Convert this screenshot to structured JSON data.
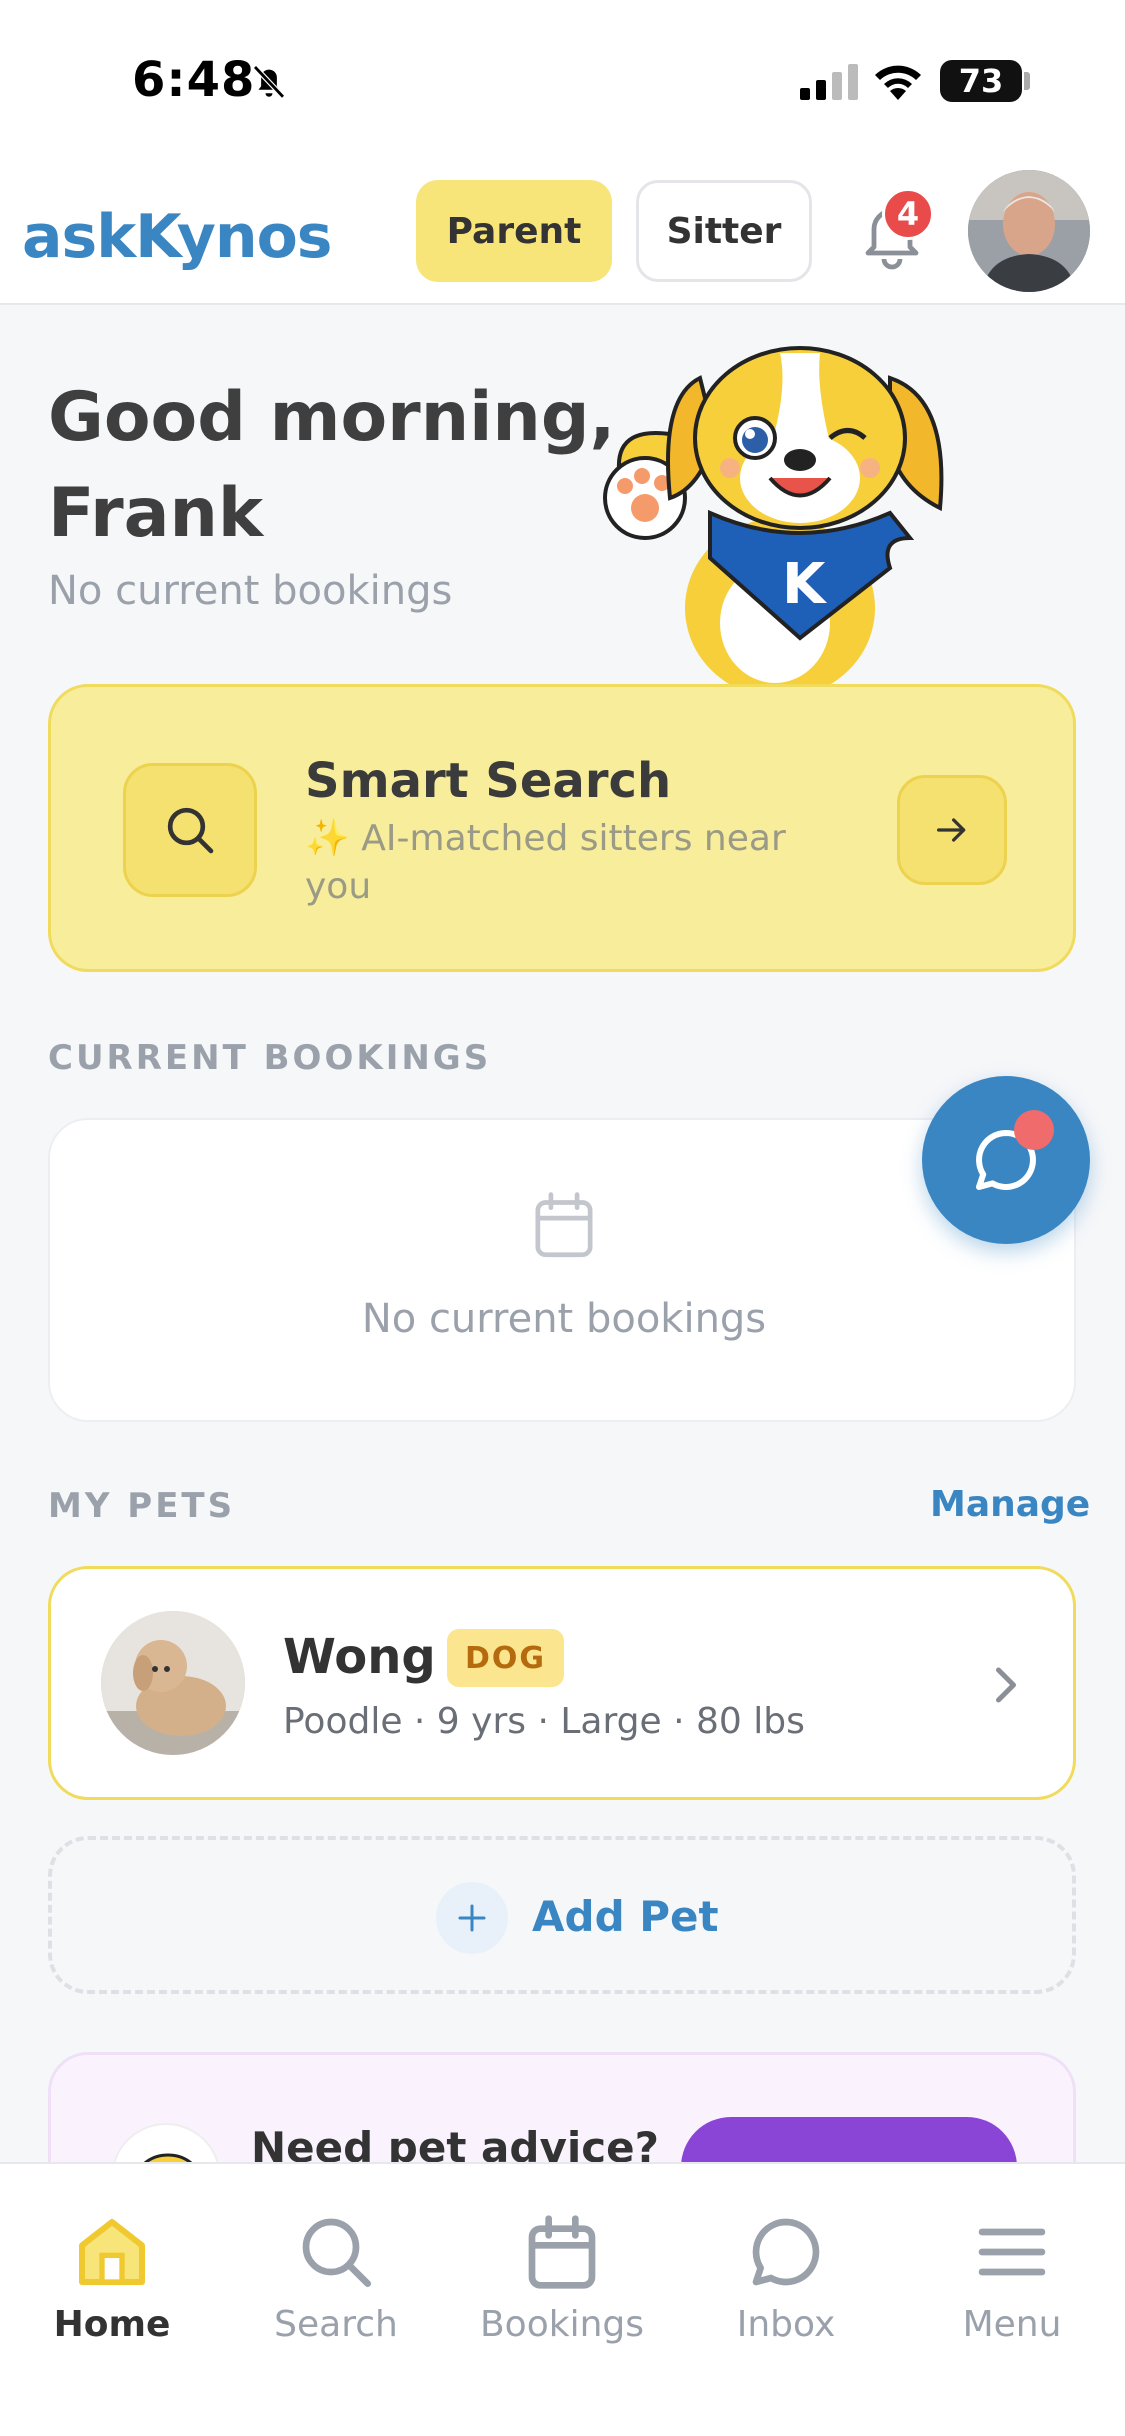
{
  "status_bar": {
    "time": "6:48",
    "battery": "73"
  },
  "header": {
    "logo": "askKynos",
    "parent_label": "Parent",
    "sitter_label": "Sitter",
    "notification_count": "4"
  },
  "greeting": {
    "title": "Good morning, Frank",
    "subtitle": "No current bookings"
  },
  "smart_search": {
    "title": "Smart Search",
    "subtitle": "✨ AI-matched sitters near you"
  },
  "current_bookings": {
    "section_label": "CURRENT BOOKINGS",
    "empty_text": "No current bookings"
  },
  "my_pets": {
    "section_label": "MY PETS",
    "manage_label": "Manage",
    "pets": [
      {
        "name": "Wong",
        "type": "DOG",
        "details": "Poodle · 9 yrs · Large · 80 lbs"
      }
    ],
    "add_label": "Add Pet"
  },
  "advice": {
    "title": "Need pet advice?"
  },
  "bottom_nav": {
    "items": [
      {
        "label": "Home",
        "icon": "home-icon"
      },
      {
        "label": "Search",
        "icon": "search-icon"
      },
      {
        "label": "Bookings",
        "icon": "calendar-icon"
      },
      {
        "label": "Inbox",
        "icon": "chat-icon"
      },
      {
        "label": "Menu",
        "icon": "menu-icon"
      }
    ]
  },
  "colors": {
    "accent_yellow": "#f8e57a",
    "brand_blue": "#3a86c3",
    "badge_red": "#e94a4a"
  }
}
